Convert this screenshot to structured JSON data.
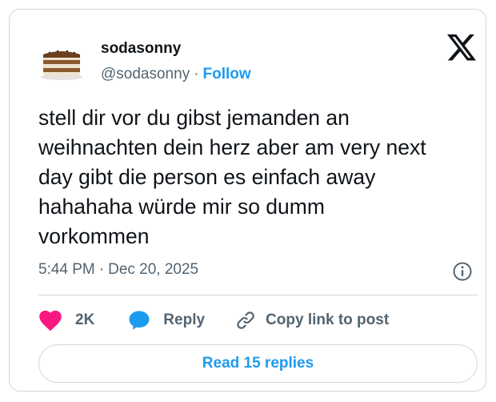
{
  "author": {
    "name": "sodasonny",
    "handle": "@sodasonny",
    "separator": "·",
    "follow_label": "Follow",
    "avatar_icon": "tiramisu-icon"
  },
  "brand": {
    "logo_icon": "x-logo-icon"
  },
  "tweet": {
    "lines": [
      "stell dir vor du gibst jemanden an",
      "weihnachten dein herz aber am very next",
      "day gibt die person es einfach away",
      "hahahaha würde mir so dumm",
      "vorkommen"
    ],
    "time": "5:44 PM",
    "separator": "·",
    "date": "Dec 20, 2025"
  },
  "actions": {
    "like_count": "2K",
    "reply_label": "Reply",
    "copy_label": "Copy link to post"
  },
  "read_replies_label": "Read 15 replies",
  "colors": {
    "accent": "#1d9bf0",
    "like": "#f91880",
    "text": "#0f1419",
    "muted": "#536471",
    "border": "#cfd9de"
  }
}
